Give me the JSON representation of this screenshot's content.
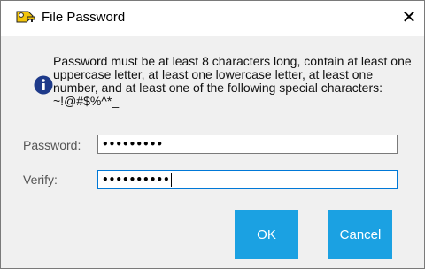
{
  "window": {
    "title": "File Password",
    "close_glyph": "✕",
    "title_icon": "key-icon"
  },
  "message": {
    "icon": "info-icon",
    "text": "Password must be at least 8 characters long, contain at least one uppercase letter, at least one lowercase letter, at least one number, and at least one of the following special characters: ~!@#$%^*_"
  },
  "fields": {
    "password": {
      "label": "Password:",
      "value_masked": "•••••••••"
    },
    "verify": {
      "label": "Verify:",
      "value_masked": "••••••••••"
    }
  },
  "buttons": {
    "ok": "OK",
    "cancel": "Cancel"
  },
  "colors": {
    "button_bg": "#1ba1e2",
    "title_bg": "#ffffff",
    "window_bg": "#f0f0f0",
    "info_icon": "#1e3a8a"
  }
}
